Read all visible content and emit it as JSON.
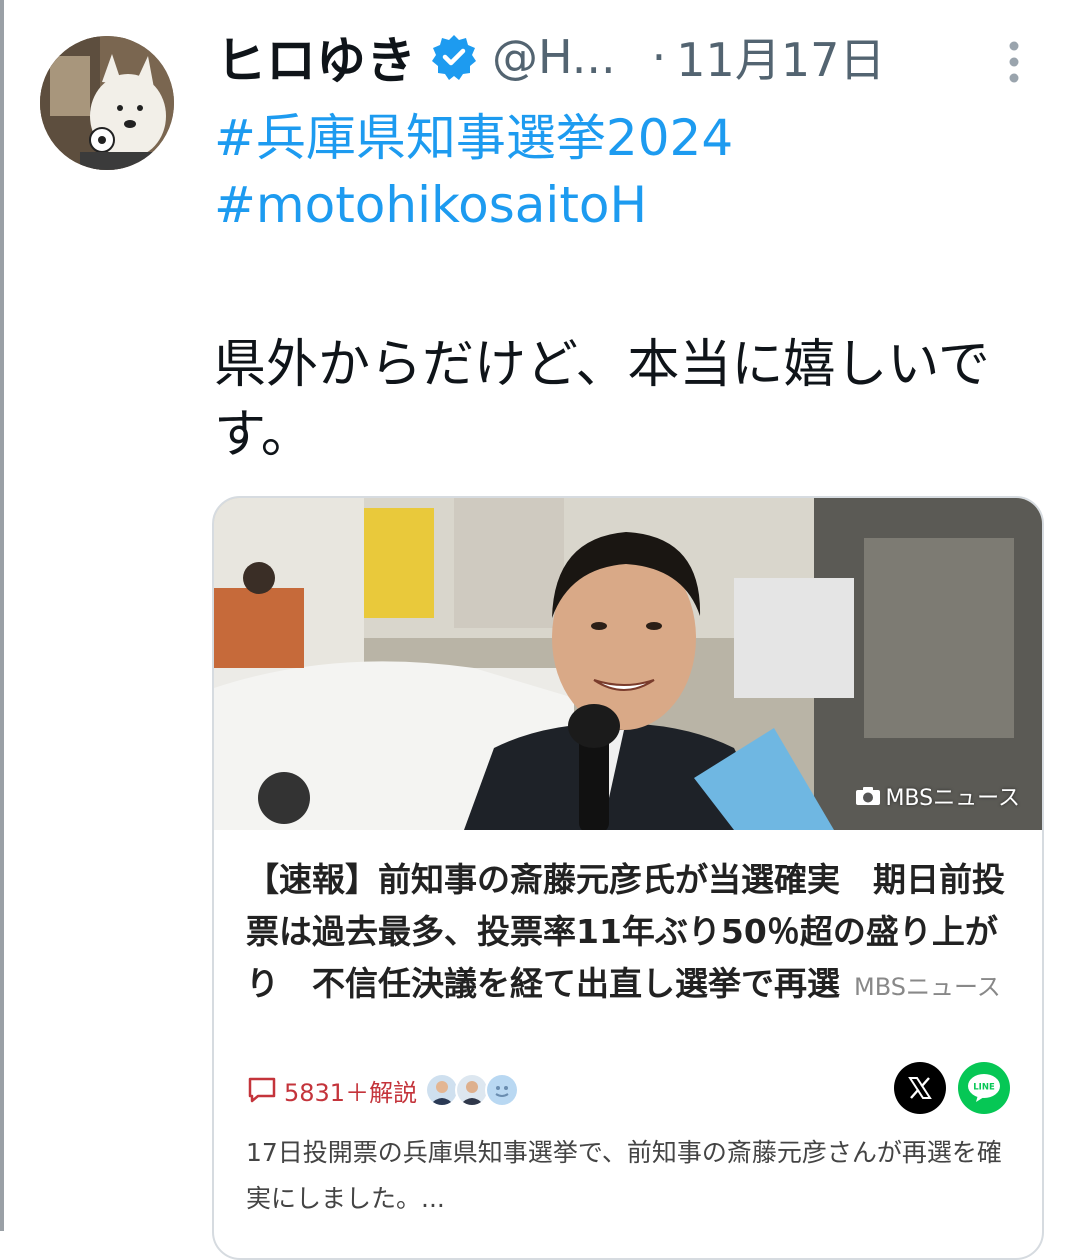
{
  "tweet": {
    "display_name": "ヒロゆき",
    "handle": "@H...",
    "separator": "·",
    "date": "11月17日",
    "hashtags": [
      "#兵庫県知事選挙2024",
      "#motohikosaitoH"
    ],
    "text": "県外からだけど、本当に嬉しいです。"
  },
  "card": {
    "photo_credit": "MBSニュース",
    "headline": "【速報】前知事の斎藤元彦氏が当選確実　期日前投票は過去最多、投票率11年ぶり50％超の盛り上がり　不信任決議を経て出直し選挙で再選",
    "source": "MBSニュース",
    "comment_count": "5831＋解説",
    "share_line_label": "LINE",
    "summary": "17日投開票の兵庫県知事選挙で、前知事の斎藤元彦さんが再選を確実にしました。..."
  },
  "icons": {
    "verified": "verified-badge-icon",
    "more": "more-vertical-icon",
    "camera": "camera-icon",
    "comment": "comment-icon",
    "share_x": "x-logo-icon",
    "share_line": "line-logo-icon"
  },
  "colors": {
    "link": "#1d9bf0",
    "secondary": "#536471",
    "comment": "#c4343b",
    "line_green": "#06c755"
  }
}
